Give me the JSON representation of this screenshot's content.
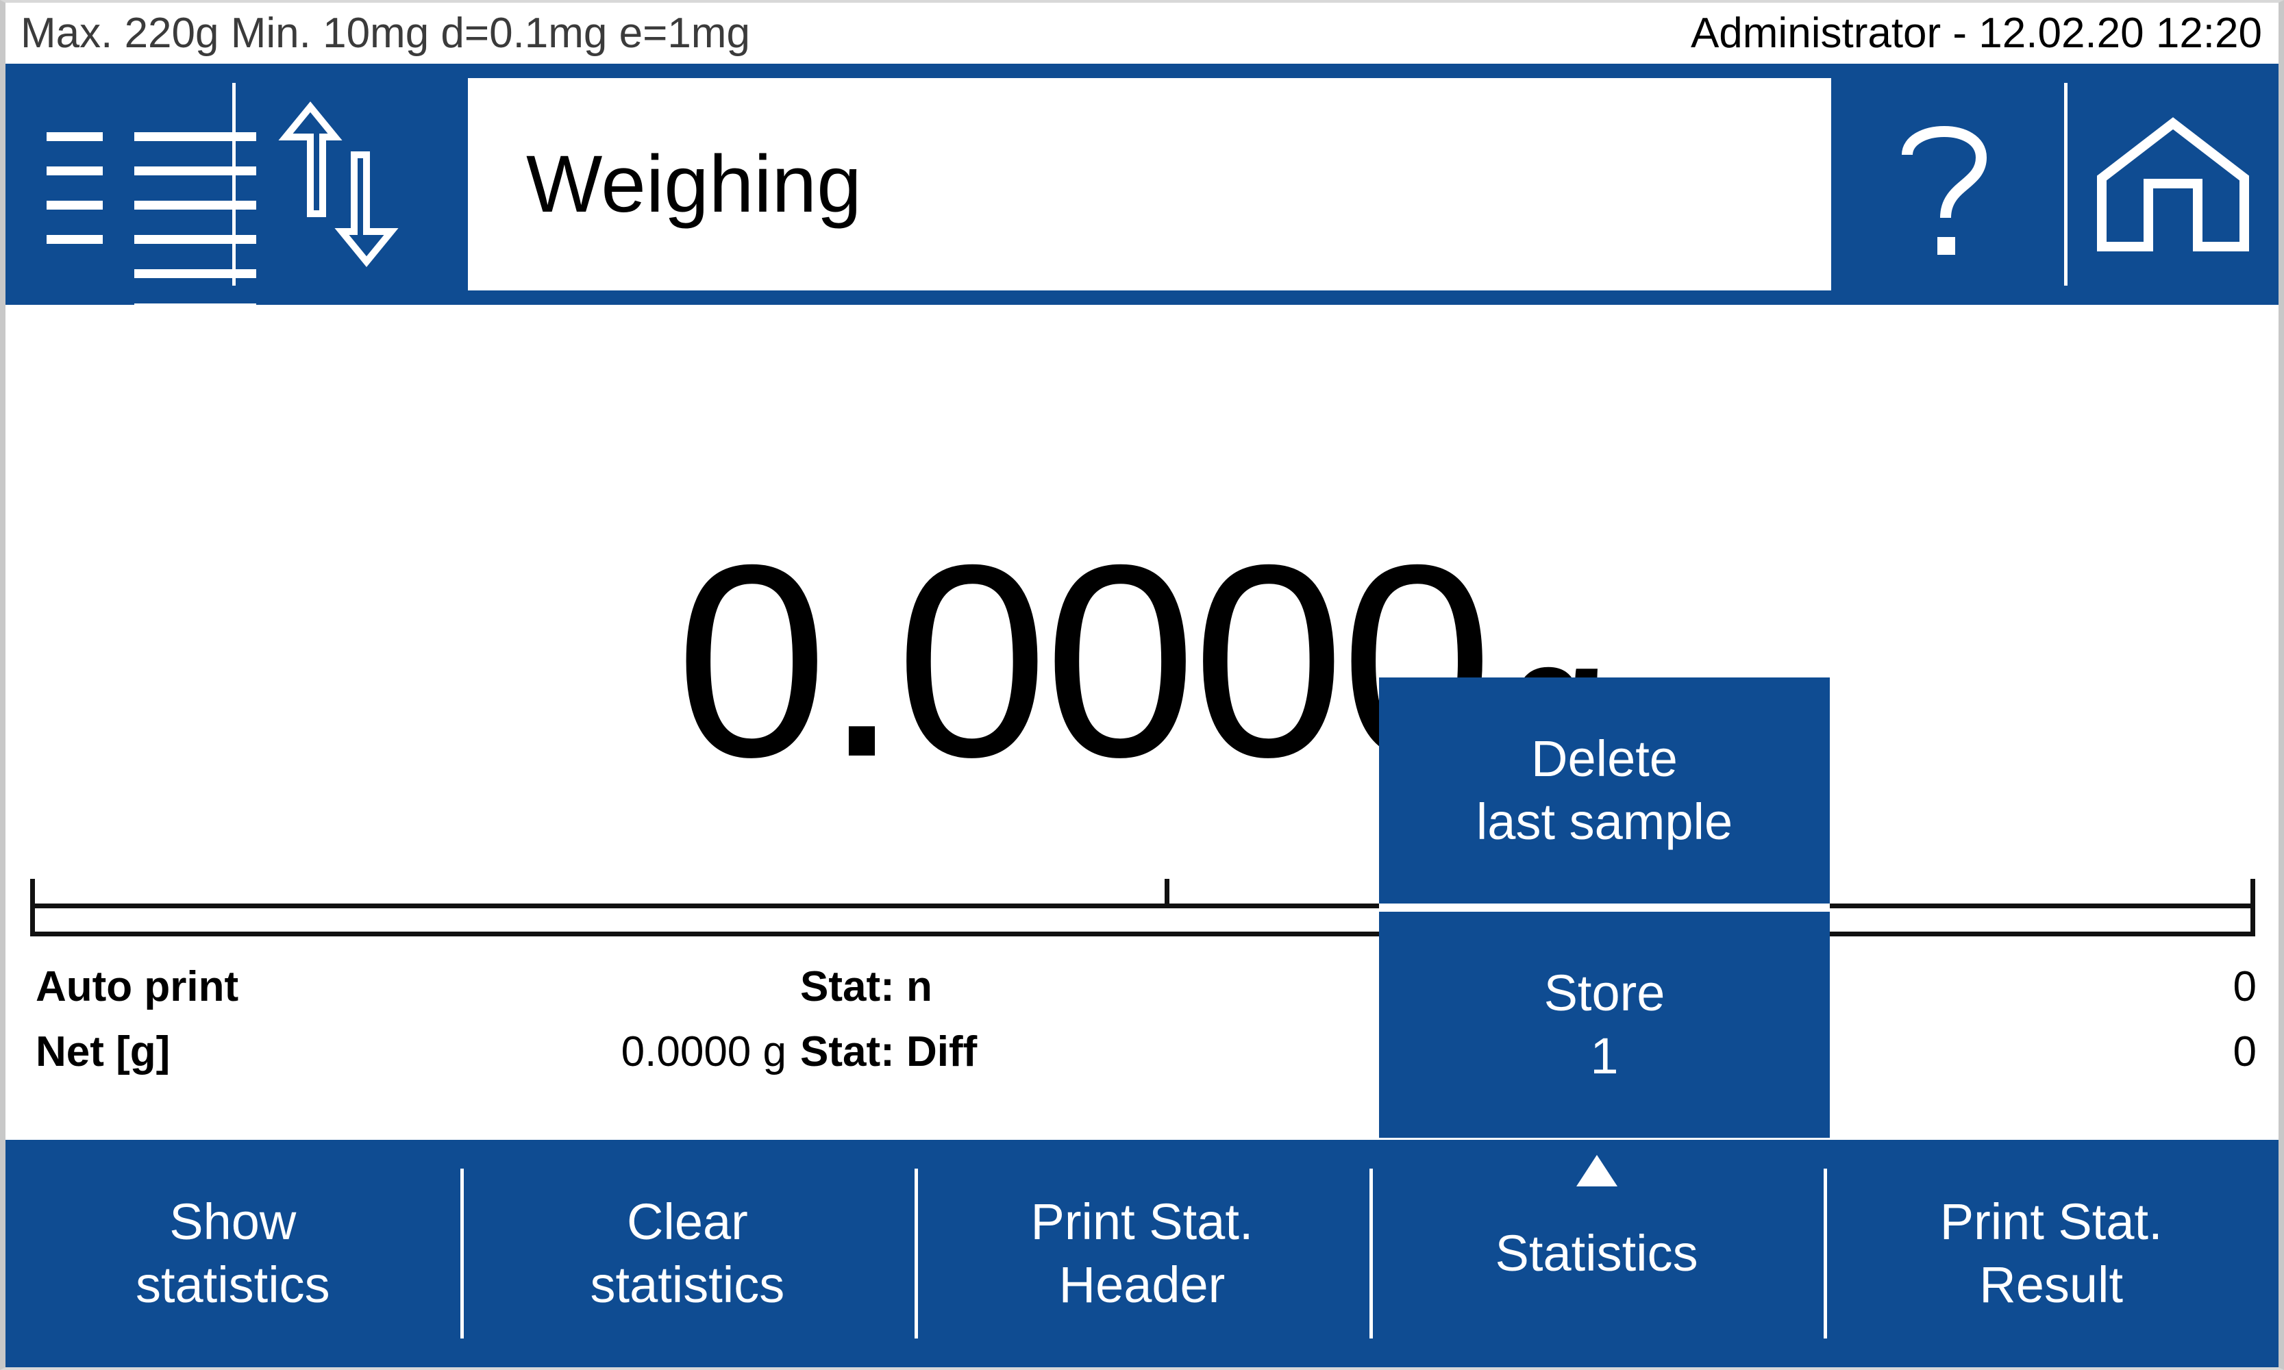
{
  "statusbar": {
    "specs": "Max. 220g  Min. 10mg  d=0.1mg  e=1mg",
    "user_datetime": "Administrator - 12.02.20 12:20"
  },
  "toolbar": {
    "menu_icon": "list-menu-icon",
    "units_icon": "up-down-arrows-icon",
    "title": "Weighing",
    "help_icon": "question-mark-icon",
    "home_icon": "home-icon"
  },
  "display": {
    "value": "0.0000",
    "unit": "g",
    "bargraph": {
      "min_label": "",
      "ticks": [
        0,
        50,
        100
      ]
    }
  },
  "info_rows": [
    {
      "label": "Auto print",
      "mid": "",
      "stat_label": "Stat: n",
      "value": "0"
    },
    {
      "label": "Net [g]",
      "mid": "0.0000 g",
      "stat_label": "Stat: Diff",
      "value": "0"
    }
  ],
  "function_bar": [
    {
      "line1": "Show",
      "line2": "statistics",
      "caret": false
    },
    {
      "line1": "Clear",
      "line2": "statistics",
      "caret": false
    },
    {
      "line1": "Print Stat.",
      "line2": "Header",
      "caret": false
    },
    {
      "line1": "Statistics",
      "line2": "",
      "caret": true
    },
    {
      "line1": "Print Stat.",
      "line2": "Result",
      "caret": false
    }
  ],
  "popup_menu": {
    "items": [
      {
        "line1": "Delete",
        "line2": "last sample"
      },
      {
        "line1": "Store",
        "line2": "1"
      }
    ]
  },
  "colors": {
    "brand_blue": "#0F4C92",
    "text_black": "#000000",
    "status_gray": "#3B3B3B",
    "bezel_gray": "#C8C8C8"
  }
}
